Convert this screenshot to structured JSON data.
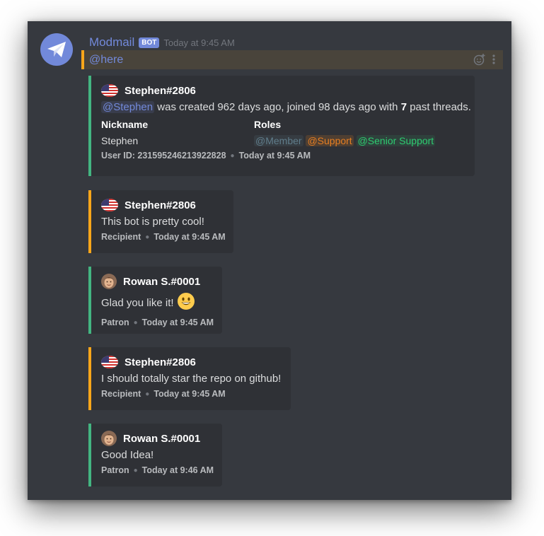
{
  "header": {
    "bot_name": "Modmail",
    "bot_tag": "BOT",
    "timestamp": "Today at 9:45 AM",
    "mention": "@here"
  },
  "info_embed": {
    "author": "Stephen#2806",
    "mention": "@Stephen",
    "desc_part1": "was created 962 days ago, joined 98 days ago with",
    "thread_count": "7",
    "desc_part2": "past threads.",
    "fields": {
      "nickname_title": "Nickname",
      "nickname_value": "Stephen",
      "roles_title": "Roles",
      "roles": [
        {
          "name": "@Member",
          "color": "#607d8b"
        },
        {
          "name": "@Support",
          "color": "#e67e22"
        },
        {
          "name": "@Senior Support",
          "color": "#2ecc71"
        }
      ]
    },
    "footer_id": "User ID: 231595246213922828",
    "footer_time": "Today at 9:45 AM"
  },
  "messages": [
    {
      "author": "Stephen#2806",
      "text": "This bot is pretty cool!",
      "role": "Recipient",
      "time": "Today at 9:45 AM",
      "kind": "recipient"
    },
    {
      "author": "Rowan S.#0001",
      "text": "Glad you like it!",
      "role": "Patron",
      "time": "Today at 9:45 AM",
      "kind": "staff",
      "emoji": "smiley"
    },
    {
      "author": "Stephen#2806",
      "text": "I should totally star the repo on github!",
      "role": "Recipient",
      "time": "Today at 9:45 AM",
      "kind": "recipient"
    },
    {
      "author": "Rowan S.#0001",
      "text": "Good Idea!",
      "role": "Patron",
      "time": "Today at 9:46 AM",
      "kind": "staff"
    }
  ],
  "colors": {
    "background": "#36393f",
    "embed_bg": "#2f3136",
    "accent": "#7289da",
    "staff_border": "#43b581",
    "recipient_border": "#faa61a"
  },
  "icons": {
    "bot_avatar": "envelope-icon",
    "recipient_avatar": "us-flag-icon",
    "staff_avatar": "user-avatar",
    "add_reaction": "add-reaction-icon",
    "more": "more-options-icon"
  }
}
